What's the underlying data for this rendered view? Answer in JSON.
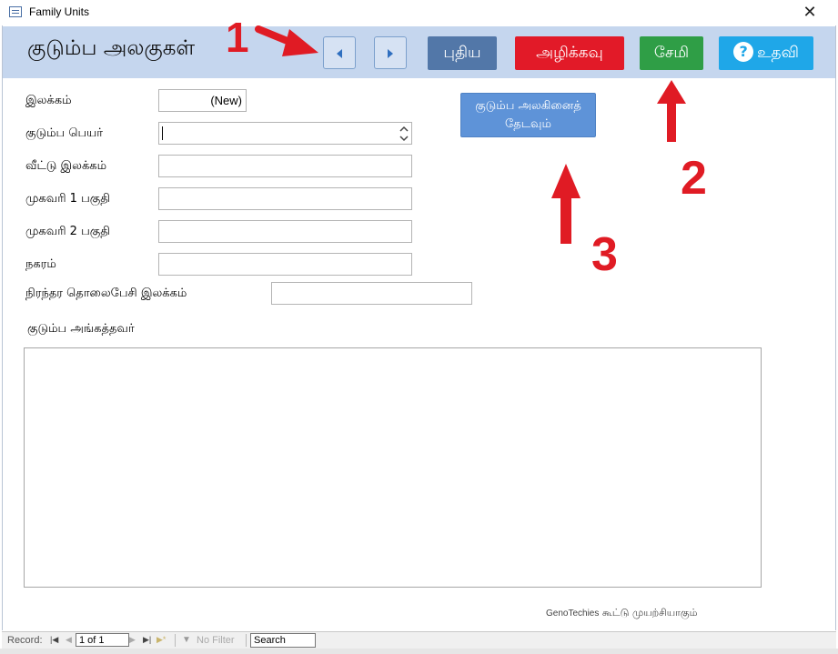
{
  "window": {
    "title": "Family Units",
    "close_glyph": "✕"
  },
  "header": {
    "form_title": "குடும்ப அலகுகள்",
    "new_label": "புதிய",
    "delete_label": "அழிக்கவு",
    "save_label": "சேமி",
    "help_label": "உதவி",
    "help_icon_glyph": "?",
    "colors": {
      "band": "#c5d6ee",
      "new": "#5277a8",
      "delete": "#e21a28",
      "save": "#2f9e46",
      "help": "#1fa7e8"
    }
  },
  "annotations": {
    "one": "1",
    "two": "2",
    "three": "3",
    "color": "#e01b24"
  },
  "form": {
    "number_label": "இலக்கம்",
    "number_value": "(New)",
    "family_name_label": "குடும்ப பெயர்",
    "house_number_label": "வீட்டு இலக்கம்",
    "address1_label": "முகவரி 1 பகுதி",
    "address2_label": "முகவரி 2 பகுதி",
    "city_label": "நகரம்",
    "phone_label": "நிரந்தர தொலைபேசி இலக்கம்",
    "search_button_line1": "குடும்ப அலகினைத்",
    "search_button_line2": "தேடவும்",
    "members_label": "குடும்ப அங்கத்தவர்"
  },
  "footer": {
    "credit_en": "GenoTechies",
    "credit_ta": "கூட்டு முயற்சியாகும்"
  },
  "record_bar": {
    "record_label": "Record:",
    "current": "1 of 1",
    "no_filter": "No Filter",
    "search": "Search"
  },
  "icons": [
    "app-form-icon",
    "close-icon",
    "left-arrow-icon",
    "right-arrow-icon",
    "help-icon",
    "spinner-icon",
    "filter-icon"
  ]
}
